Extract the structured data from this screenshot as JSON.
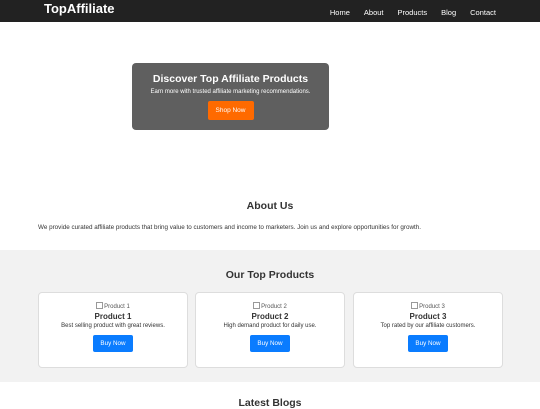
{
  "header": {
    "brand": "TopAffiliate",
    "nav": [
      "Home",
      "About",
      "Products",
      "Blog",
      "Contact"
    ]
  },
  "hero": {
    "title": "Discover Top Affiliate Products",
    "subtitle": "Earn more with trusted affiliate marketing recommendations.",
    "button": "Shop Now"
  },
  "about": {
    "title": "About Us",
    "text": "We provide curated affiliate products that bring value to customers and income to marketers. Join us and explore opportunities for growth."
  },
  "products": {
    "title": "Our Top Products",
    "items": [
      {
        "image_alt": "Product 1",
        "name": "Product 1",
        "desc": "Best selling product with great reviews.",
        "button": "Buy Now"
      },
      {
        "image_alt": "Product 2",
        "name": "Product 2",
        "desc": "High demand product for daily use.",
        "button": "Buy Now"
      },
      {
        "image_alt": "Product 3",
        "name": "Product 3",
        "desc": "Top rated by our affiliate customers.",
        "button": "Buy Now"
      }
    ]
  },
  "blog": {
    "title": "Latest Blogs"
  },
  "colors": {
    "nav_bg": "#222222",
    "accent_orange": "#ff6a00",
    "accent_blue": "#0a7cff",
    "section_bg": "#f2f2f2"
  }
}
